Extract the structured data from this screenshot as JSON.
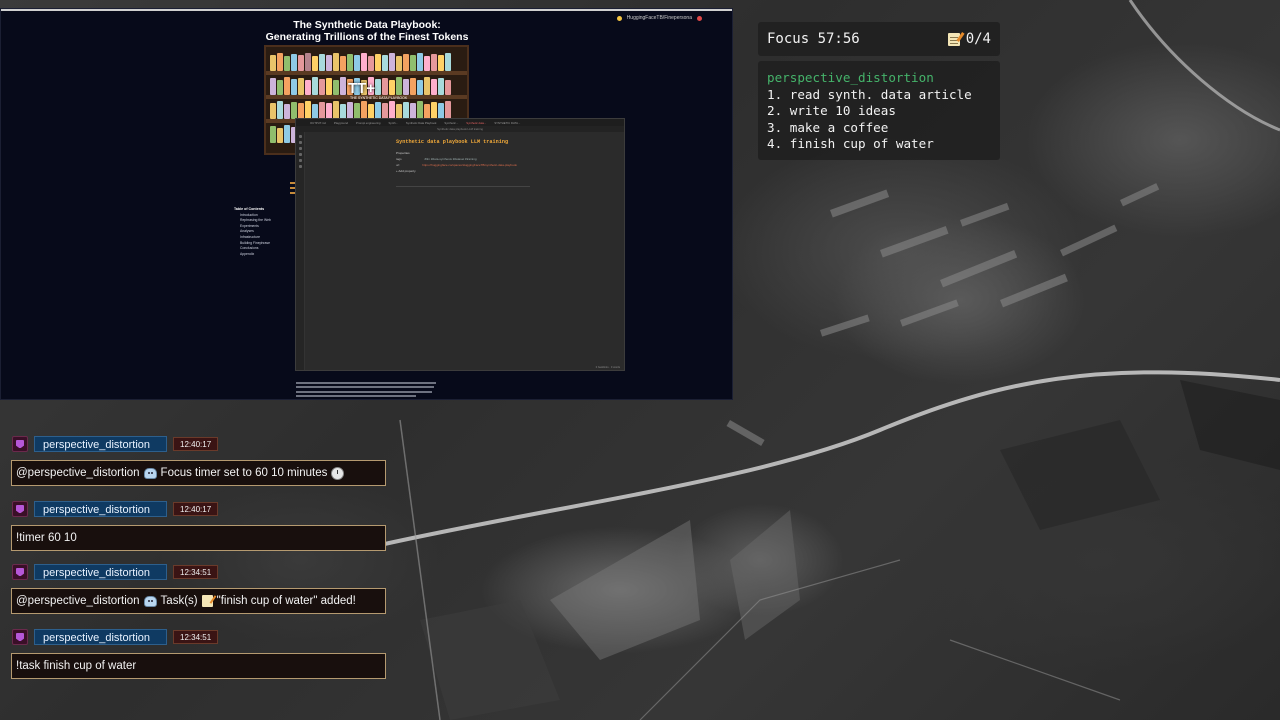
{
  "browser": {
    "tab_label": "HuggingFaceTB/Finepersona",
    "article_title_line1": "The Synthetic Data Playbook:",
    "article_title_line2": "Generating Trillions of the Finest Tokens",
    "hero_logo": "TT+",
    "hero_sub": "THE SYNTHETIC DATA PLAYBOOK",
    "toc_heading": "Table of Contents",
    "toc_items": [
      "Introduction",
      "Rephrasing the Web",
      "Experiments",
      "Analyses",
      "Infrastructure",
      "Building Finephrase",
      "Conclusions",
      "Appendix"
    ]
  },
  "editor": {
    "tabs": [
      "OUTPUT.md",
      "Playground",
      "Prompt engineering",
      "Synth...",
      "Synthetic Data Playbook",
      "Synthetic...",
      "Synthetic data...",
      "SYNTHETIC DATA..."
    ],
    "address": "Synthetic data playbook LLM training",
    "doc_title": "Synthetic data playbook LLM training",
    "props_heading": "Properties",
    "prop_tags_key": "tags",
    "prop_tags_value": "#llm #data-synthesis #dataset #training",
    "prop_url_key": "url",
    "prop_url_value": "https://huggingface.co/spaces/HuggingFaceTB/synthetic-data-playbook",
    "add_property": "+ Add property",
    "status": "0 backlinks · 0 words"
  },
  "focus": {
    "label": "Focus 57:56",
    "task_count": "0/4"
  },
  "tasks": {
    "username": "perspective_distortion",
    "items": [
      "1. read synth. data article",
      "2. write 10 ideas",
      "3. make a coffee",
      "4. finish cup of water"
    ]
  },
  "chat": [
    {
      "user": "perspective_distortion",
      "time": "12:40:17",
      "mention": "@perspective_distortion",
      "text": "Focus timer set to 60 10 minutes"
    },
    {
      "user": "perspective_distortion",
      "time": "12:40:17",
      "text": "!timer 60 10"
    },
    {
      "user": "perspective_distortion",
      "time": "12:34:51",
      "mention": "@perspective_distortion",
      "text_a": "Task(s)",
      "text_b": "\"finish cup of water\" added!"
    },
    {
      "user": "perspective_distortion",
      "time": "12:34:51",
      "text": "!task finish cup of water"
    }
  ],
  "colors": {
    "task_username": "#45b36a",
    "doc_title": "#f0a93a",
    "chat_name_bg": "#0f3a62",
    "chat_msg_border": "#b59a70"
  }
}
